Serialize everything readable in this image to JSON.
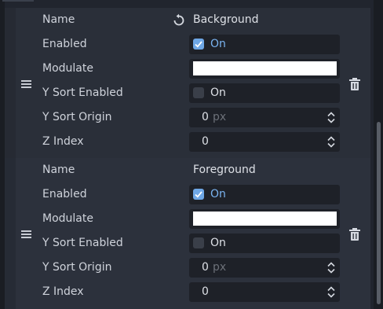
{
  "layers": [
    {
      "name_label": "Name",
      "name_value": "Background",
      "enabled_label": "Enabled",
      "enabled_value": "On",
      "enabled_checked": true,
      "modulate_label": "Modulate",
      "modulate_color": "#ffffff",
      "y_sort_enabled_label": "Y Sort Enabled",
      "y_sort_enabled_value": "On",
      "y_sort_enabled_checked": false,
      "y_sort_origin_label": "Y Sort Origin",
      "y_sort_origin_value": "0",
      "y_sort_origin_unit": "px",
      "z_index_label": "Z Index",
      "z_index_value": "0"
    },
    {
      "name_label": "Name",
      "name_value": "Foreground",
      "enabled_label": "Enabled",
      "enabled_value": "On",
      "enabled_checked": true,
      "modulate_label": "Modulate",
      "modulate_color": "#ffffff",
      "y_sort_enabled_label": "Y Sort Enabled",
      "y_sort_enabled_value": "On",
      "y_sort_enabled_checked": false,
      "y_sort_origin_label": "Y Sort Origin",
      "y_sort_origin_value": "0",
      "y_sort_origin_unit": "px",
      "z_index_label": "Z Index",
      "z_index_value": "0"
    }
  ],
  "icons": {
    "revert": "revert-icon",
    "drag_handle": "drag-handle-icon",
    "delete": "trash-icon",
    "checkbox_check": "checkmark-icon",
    "spinner": "spinner-arrows-icon"
  },
  "colors": {
    "accent": "#6ea7e6",
    "accent_text": "#7ab3f0",
    "background": "#21252e"
  }
}
